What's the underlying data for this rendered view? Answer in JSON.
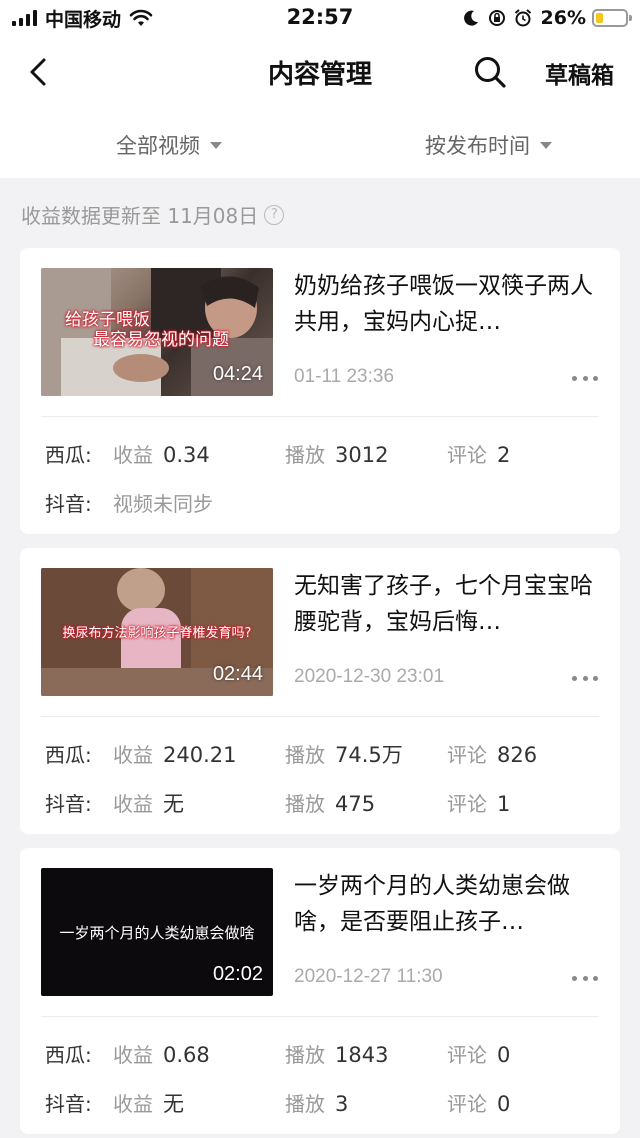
{
  "status_bar": {
    "carrier": "中国移动",
    "time": "22:57",
    "battery_pct": "26%",
    "battery_level": 0.26,
    "battery_color": "#f5c518"
  },
  "nav": {
    "title": "内容管理",
    "draft_label": "草稿箱",
    "back_icon": "chevron-left-icon",
    "search_icon": "search-icon"
  },
  "filters": {
    "all_videos": "全部视频",
    "sort_by_time": "按发布时间"
  },
  "notice": {
    "text": "收益数据更新至 11月08日",
    "help_icon": "?"
  },
  "videos": [
    {
      "title": "奶奶给孩子喂饭一双筷子两人共用，宝妈内心捉…",
      "date": "01-11 23:36",
      "duration": "04:24",
      "thumb_caption_line1": "给孩子喂饭",
      "thumb_caption_line2": "最容易忽视的问题",
      "xigua": {
        "platform": "西瓜:",
        "income_label": "收益",
        "income": "0.34",
        "plays_label": "播放",
        "plays": "3012",
        "comments_label": "评论",
        "comments": "2"
      },
      "douyin": {
        "platform": "抖音:",
        "note": "视频未同步"
      }
    },
    {
      "title": "无知害了孩子，七个月宝宝哈腰驼背，宝妈后悔…",
      "date": "2020-12-30 23:01",
      "duration": "02:44",
      "thumb_caption_line1": "换尿布方法影响孩子脊椎发育吗?",
      "xigua": {
        "platform": "西瓜:",
        "income_label": "收益",
        "income": "240.21",
        "plays_label": "播放",
        "plays": "74.5万",
        "comments_label": "评论",
        "comments": "826"
      },
      "douyin": {
        "platform": "抖音:",
        "income_label": "收益",
        "income": "无",
        "plays_label": "播放",
        "plays": "475",
        "comments_label": "评论",
        "comments": "1"
      }
    },
    {
      "title": "一岁两个月的人类幼崽会做啥，是否要阻止孩子…",
      "date": "2020-12-27 11:30",
      "duration": "02:02",
      "thumb_caption_line1": "一岁两个月的人类幼崽会做啥",
      "xigua": {
        "platform": "西瓜:",
        "income_label": "收益",
        "income": "0.68",
        "plays_label": "播放",
        "plays": "1843",
        "comments_label": "评论",
        "comments": "0"
      },
      "douyin": {
        "platform": "抖音:",
        "income_label": "收益",
        "income": "无",
        "plays_label": "播放",
        "plays": "3",
        "comments_label": "评论",
        "comments": "0"
      }
    }
  ]
}
